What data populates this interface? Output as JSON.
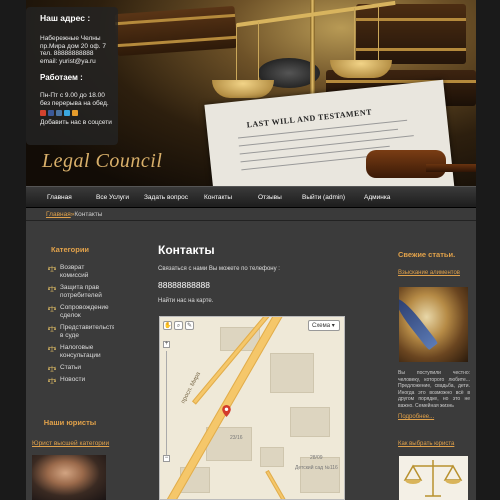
{
  "site": {
    "brand": "Legal Council"
  },
  "contact_panel": {
    "address_title": "Наш адрес :",
    "address_lines": [
      "Набережные Челны",
      "пр.Мира дом 20 оф. 7",
      "тел. 88888888888",
      "email: yurist@ya.ru"
    ],
    "hours_title": "Работаем :",
    "hours_lines": [
      "Пн-Пт с 9.00 до 18.00",
      "без перерыва на обед."
    ],
    "social_label": "Добавить нас в соцсети",
    "social_icons": [
      "g-icon",
      "facebook-icon",
      "vk-icon",
      "twitter-icon",
      "email-icon"
    ]
  },
  "header_art": {
    "document_title": "LAST WILL AND TESTAMENT"
  },
  "nav": {
    "items": [
      "Главная",
      "Все Услуги",
      "Задать вопрос",
      "Контакты",
      "Отзывы",
      "Выйти (admin)",
      "Админка"
    ]
  },
  "breadcrumb": {
    "home": "Главная",
    "separator": "»",
    "current": "Контакты"
  },
  "left_sidebar": {
    "categories_title": "Категории",
    "categories": [
      "Возврат комиссий",
      "Защита прав потребителей",
      "Сопровождение сделок",
      "Представительство в суде",
      "Налоговые консультации",
      "Статьи",
      "Новости"
    ],
    "lawyers_title": "Наши юристы",
    "lawyer_link": "Юрист высшей категории"
  },
  "main": {
    "title": "Контакты",
    "intro": "Связаться с нами Вы можете по телефону :",
    "phone": "88888888888",
    "map_intro": "Найти нас на карте.",
    "map": {
      "type_select": "Схема",
      "street_label": "просп. Мира",
      "building_label": "23/16",
      "place_label": "Детский сад №116",
      "street_no_label": "28/09",
      "zoom_in": "+",
      "zoom_out": "−"
    }
  },
  "right_sidebar": {
    "title": "Свежие статьи.",
    "article1_link": "Взыскание алиментов",
    "article1_text": "Вы поступили честно: человеку, которого любите... Предложение, свадьба, дети. Иногда это возможно всё в другом порядке, но это не важно. Семейная жизнь",
    "read_more": "Подробнее...",
    "article2_link": "Как выбрать юриста"
  }
}
